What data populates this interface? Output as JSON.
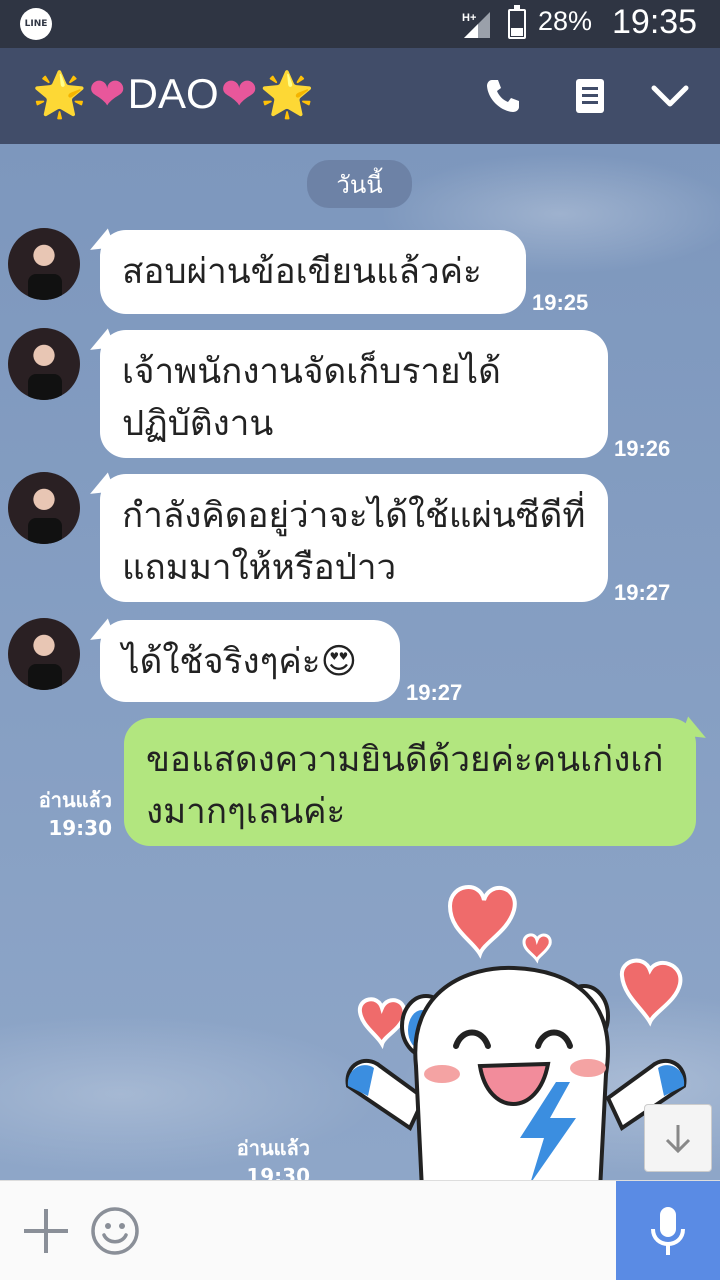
{
  "status_bar": {
    "app_logo": "LINE",
    "network": "H+",
    "battery": "28%",
    "clock": "19:35"
  },
  "header": {
    "contact_name": "DAO",
    "spark": "🌟",
    "heart": "❤"
  },
  "chat": {
    "date_label": "วันนี้",
    "messages": [
      {
        "text": "สอบผ่านข้อเขียนแล้วค่ะ",
        "time": "19:25"
      },
      {
        "text": "เจ้าพนักงานจัดเก็บรายได้ปฏิบัติงาน",
        "time": "19:26"
      },
      {
        "text": "กำลังคิดอยู่ว่าจะได้ใช้แผ่นซีดีที่แถมมาให้หรือป่าว",
        "time": "19:27"
      },
      {
        "text": "ได้ใช้จริงๆค่ะ😍",
        "time": "19:27"
      }
    ],
    "outgoing": [
      {
        "text": "ขอแสดงความยินดีด้วยค่ะคนเก่งเก่งมากๆเลนค่ะ",
        "read": "อ่านแล้ว",
        "time": "19:30"
      },
      {
        "read": "อ่านแล้ว",
        "time": "19:30",
        "sticker": "happy-robot-hearts"
      }
    ]
  },
  "colors": {
    "header_bg": "#414d69",
    "outgoing_bubble": "#b2e67f",
    "mic_button": "#5a8be4"
  }
}
